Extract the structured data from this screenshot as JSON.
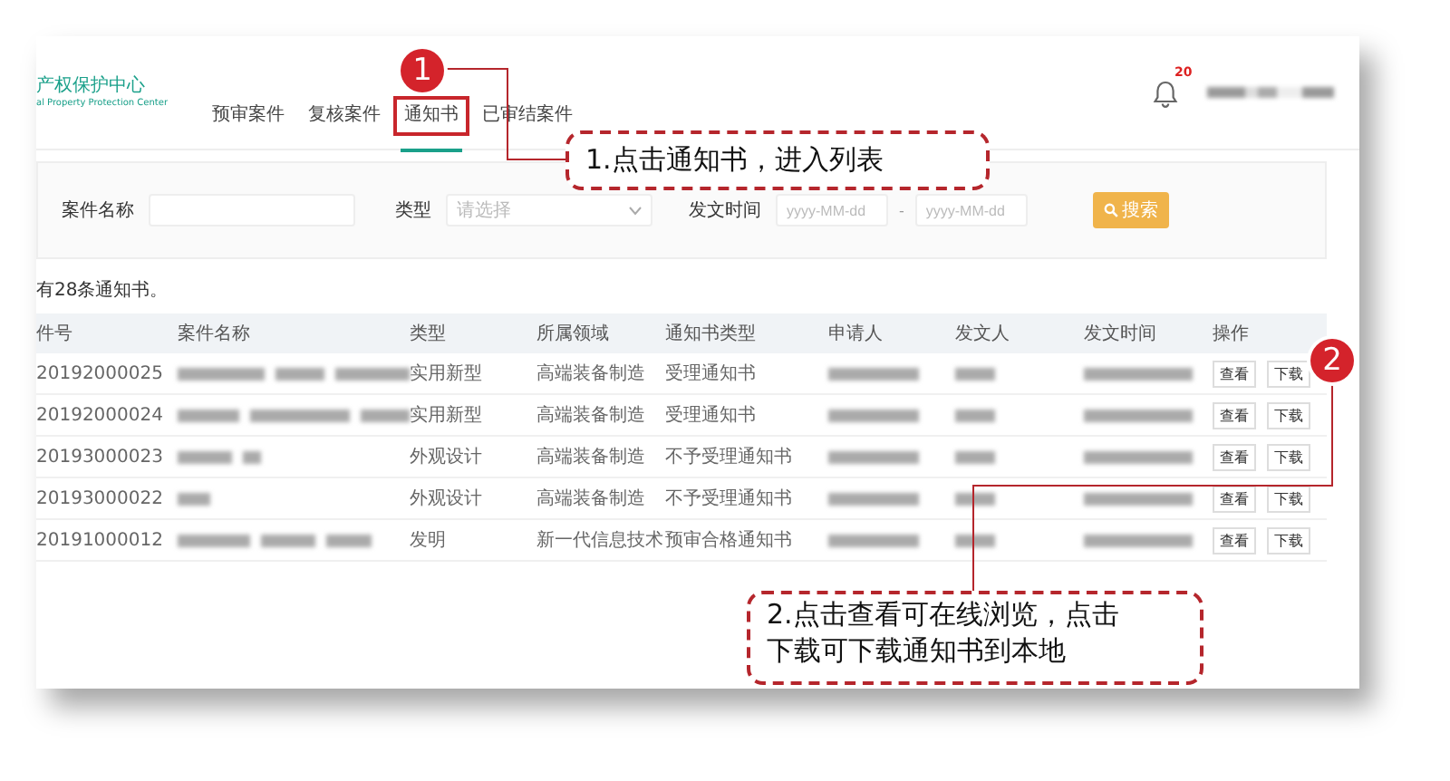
{
  "logo": {
    "title": "产权保护中心",
    "subtitle": "al Property Protection Center"
  },
  "nav": [
    {
      "label": "预审案件",
      "selected": false,
      "highlighted": false
    },
    {
      "label": "复核案件",
      "selected": false,
      "highlighted": false
    },
    {
      "label": "通知书",
      "selected": true,
      "highlighted": true
    },
    {
      "label": "已审结案件",
      "selected": false,
      "highlighted": false
    }
  ],
  "notifications": {
    "count": "20"
  },
  "user": {
    "redacted": true
  },
  "filters": {
    "case_name_label": "案件名称",
    "type_label": "类型",
    "type_placeholder": "请选择",
    "date_label": "发文时间",
    "date_from_placeholder": "yyyy-MM-dd",
    "date_separator": "-",
    "date_to_placeholder": "yyyy-MM-dd",
    "search_button": "搜索"
  },
  "summary": "有28条通知书。",
  "table": {
    "columns": [
      "件号",
      "案件名称",
      "类型",
      "所属领域",
      "通知书类型",
      "申请人",
      "发文人",
      "发文时间",
      "操作"
    ],
    "rows": [
      {
        "number": "20192000025",
        "redacted": true,
        "type": "实用新型",
        "field": "高端装备制造",
        "notice_type": "受理通知书",
        "actions": [
          "查看",
          "下载"
        ]
      },
      {
        "number": "20192000024",
        "redacted": true,
        "type": "实用新型",
        "field": "高端装备制造",
        "notice_type": "受理通知书",
        "actions": [
          "查看",
          "下载"
        ]
      },
      {
        "number": "20193000023",
        "redacted": true,
        "type": "外观设计",
        "field": "高端装备制造",
        "notice_type": "不予受理通知书",
        "actions": [
          "查看",
          "下载"
        ]
      },
      {
        "number": "20193000022",
        "redacted": true,
        "type": "外观设计",
        "field": "高端装备制造",
        "notice_type": "不予受理通知书",
        "actions": [
          "查看",
          "下载"
        ]
      },
      {
        "number": "20191000012",
        "redacted": true,
        "type": "发明",
        "field": "新一代信息技术",
        "notice_type": "预审合格通知书",
        "actions": [
          "查看",
          "下载"
        ]
      }
    ]
  },
  "annotations": [
    {
      "marker": "1",
      "text": "1.点击通知书，进入列表"
    },
    {
      "marker": "2",
      "text": "2.点击查看可在线浏览，点击下载可下载通知书到本地"
    }
  ]
}
